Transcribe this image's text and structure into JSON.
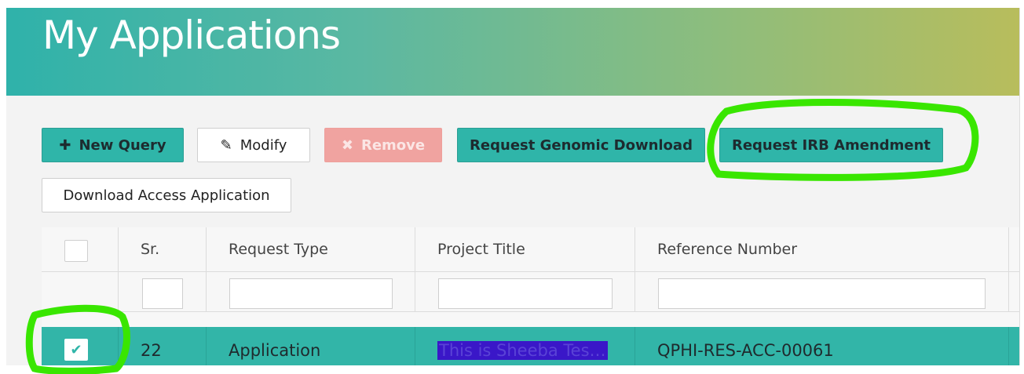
{
  "page": {
    "title": "My Applications"
  },
  "toolbar": {
    "new_query": {
      "icon": "plus-icon",
      "label": "New Query"
    },
    "modify": {
      "icon": "edit-icon",
      "label": "Modify"
    },
    "remove": {
      "icon": "close-icon",
      "label": "Remove"
    },
    "request_genomic_download": {
      "label": "Request Genomic Download"
    },
    "request_irb_amendment": {
      "label": "Request IRB Amendment"
    },
    "download_access_application": {
      "label": "Download Access Application"
    }
  },
  "table": {
    "headers": {
      "sr": "Sr.",
      "request_type": "Request Type",
      "project_title": "Project Title",
      "reference_number": "Reference Number"
    },
    "rows": [
      {
        "sr": "22",
        "request_type": "Application",
        "project_title": "This is Sheeba Tes…",
        "reference_number": "QPHI-RES-ACC-00061",
        "selected": true
      }
    ]
  },
  "colors": {
    "accent": "#2fb5a9",
    "danger_disabled": "#f0a3a0",
    "annotation": "#39e600"
  }
}
